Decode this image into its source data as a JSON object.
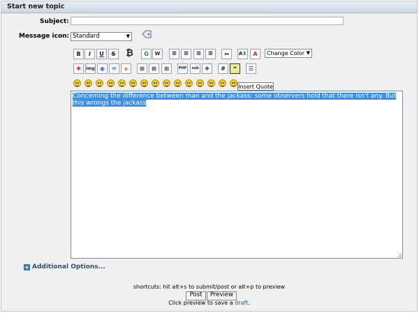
{
  "header": {
    "title": "Start new topic"
  },
  "form": {
    "subject_label": "Subject:",
    "subject_value": "",
    "icon_label": "Message icon:",
    "icon_selected": "Standard"
  },
  "toolbar": {
    "color_select": "Change Color",
    "tooltip": "Insert Quote",
    "row1_icons": [
      "bold-icon",
      "italic-icon",
      "underline-icon",
      "strikethrough-icon",
      "bitcoin-icon",
      "google-icon",
      "wikipedia-icon",
      "align-left-icon",
      "align-center-icon",
      "align-justify-icon",
      "align-right-icon",
      "horizontal-rule-icon",
      "font-size-icon",
      "font-color-icon"
    ],
    "row2_icons": [
      "flash-icon",
      "image-icon",
      "hyperlink-icon",
      "email-icon",
      "ftp-icon",
      "table-icon",
      "table-row-icon",
      "table-column-icon",
      "php-icon",
      "subscript-icon",
      "tt-icon",
      "code-icon",
      "quote-icon",
      "list-icon"
    ]
  },
  "message": {
    "text": "Concerning the difference between man and the jackass: some observers hold that there isn't any. But this wrongs the jackass"
  },
  "additional_options": {
    "label": "Additional Options..."
  },
  "footer": {
    "shortcuts": "shortcuts: hit alt+s to submit/post or alt+p to preview",
    "post_label": "Post",
    "preview_label": "Preview",
    "draft_prefix": "Click preview to save a",
    "draft_link": "draft",
    "draft_suffix": "."
  }
}
